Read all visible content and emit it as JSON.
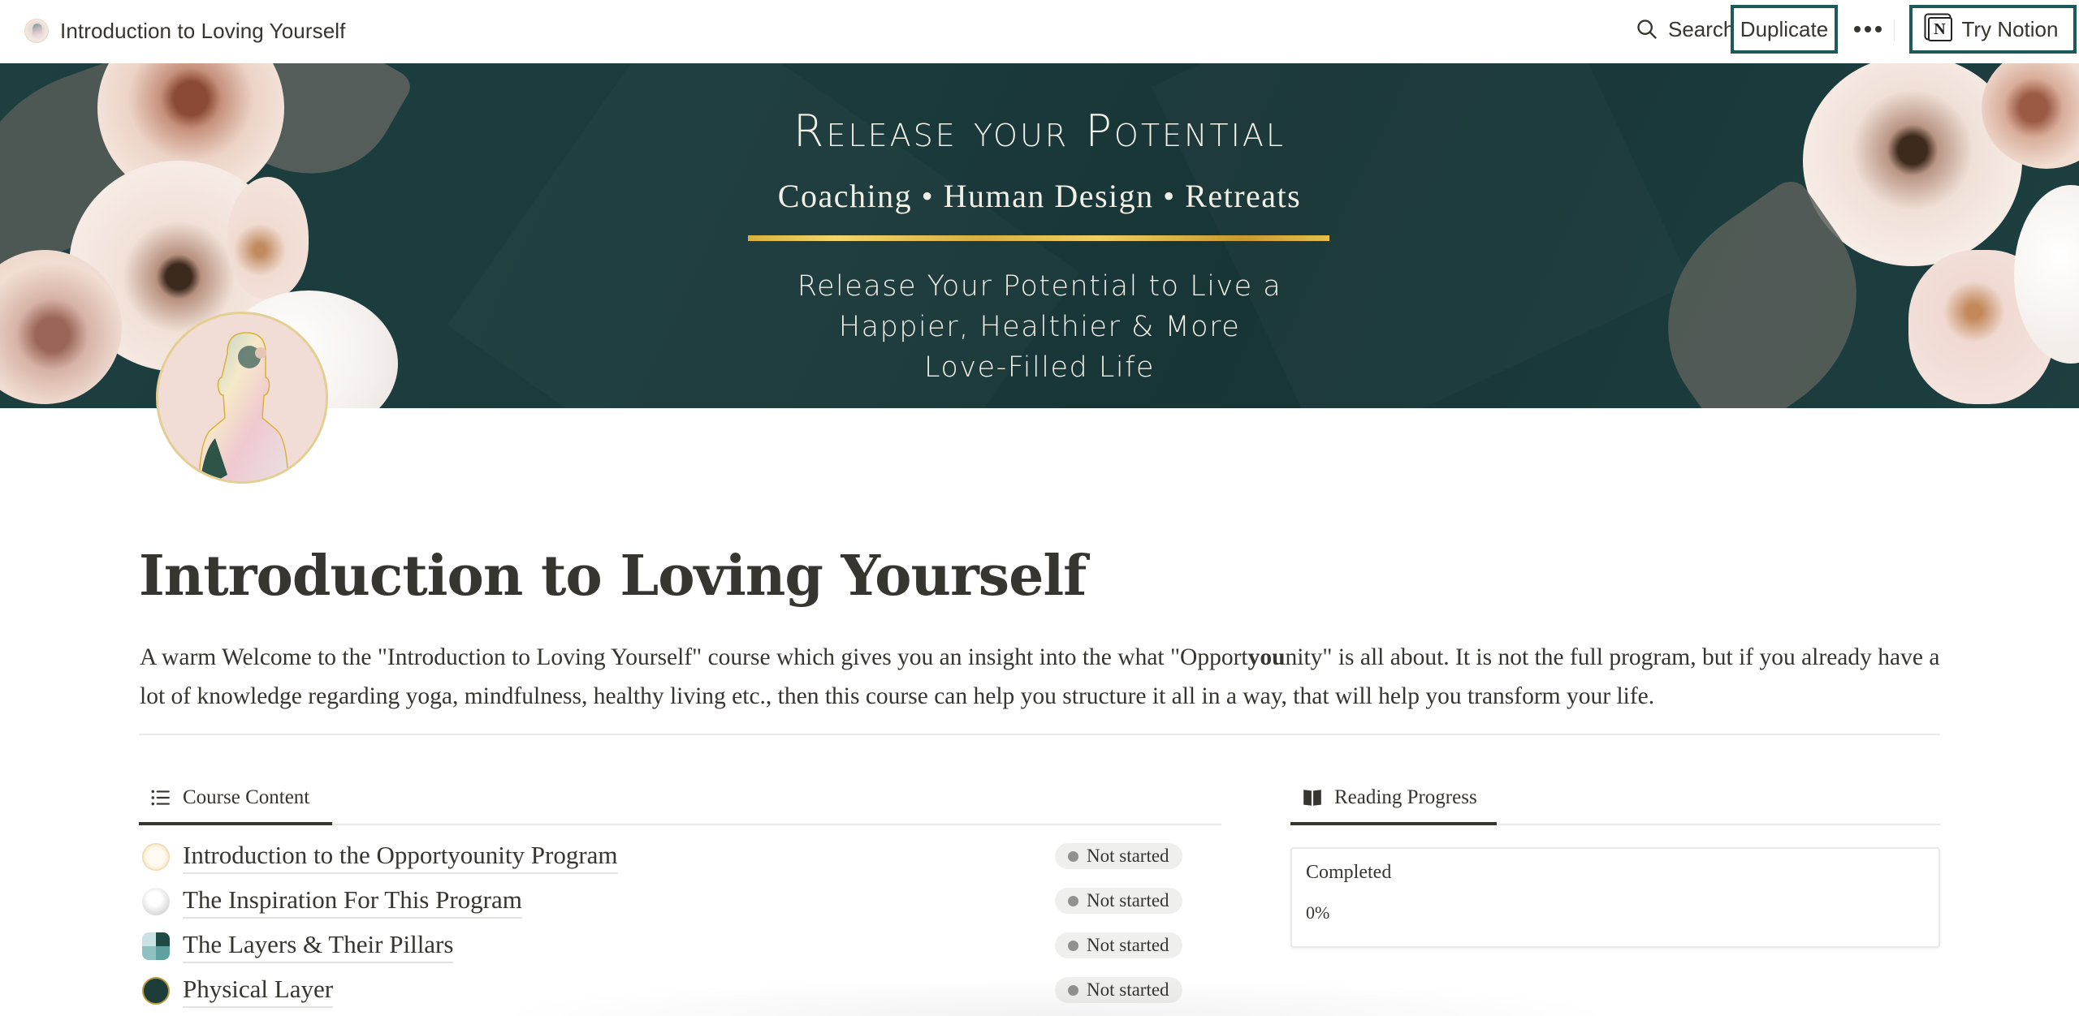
{
  "topbar": {
    "page_title": "Introduction to Loving Yourself",
    "search_label": "Search",
    "duplicate_label": "Duplicate",
    "try_notion_label": "Try Notion",
    "accent_color": "#1f5a5b"
  },
  "cover": {
    "heading": "Release your Potential",
    "subheading": "Coaching • Human Design • Retreats",
    "body_lines": [
      "Release Your Potential to Live a",
      "Happier, Healthier & More",
      "Love-Filled Life"
    ],
    "background_color": "#1c3c3d",
    "bar_color": "#e0bc48"
  },
  "page": {
    "title": "Introduction to Loving Yourself",
    "intro_part1": "A warm Welcome to the \"Introduction to Loving Yourself\" course which gives you an insight into the what \"Opport",
    "intro_bold": "you",
    "intro_part2": "nity\" is all about. It is not the full program, but if you already have a lot of knowledge regarding yoga, mindfulness, healthy living etc., then this course can help you structure it all in a way, that will help you transform your life."
  },
  "course_content": {
    "tab_label": "Course Content",
    "tab_icon": "list-icon",
    "items": [
      {
        "title": "Introduction to the Opportyounity Program",
        "icon": "lotus-badge-icon",
        "status": "Not started"
      },
      {
        "title": "The Inspiration For This Program",
        "icon": "cloud-icon",
        "status": "Not started"
      },
      {
        "title": "The Layers & Their Pillars",
        "icon": "layers-icon",
        "status": "Not started"
      },
      {
        "title": "Physical Layer",
        "icon": "muscle-arm-icon",
        "status": "Not started"
      }
    ],
    "status_dot_color": "#91918e"
  },
  "reading_progress": {
    "tab_label": "Reading Progress",
    "tab_icon": "book-icon",
    "card_label": "Completed",
    "card_value": "0%"
  }
}
